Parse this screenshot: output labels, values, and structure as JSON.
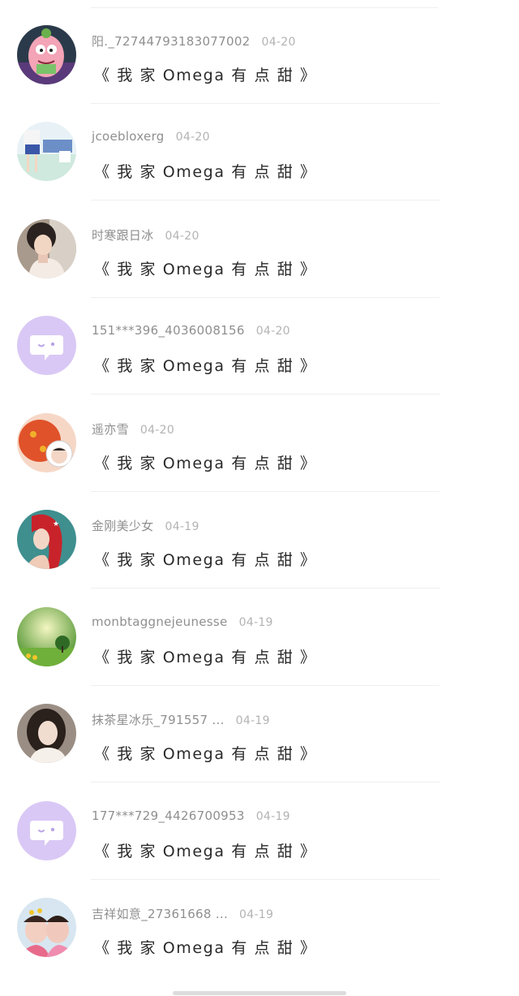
{
  "comments": [
    {
      "user": "阳._72744793183077002",
      "date": "04-20",
      "title": "《 我 家 Omega 有 点 甜 》",
      "avatar_icon": "patrick-star-avatar"
    },
    {
      "user": "jcoebloxerg",
      "date": "04-20",
      "title": "《 我 家 Omega 有 点 甜 》",
      "avatar_icon": "anime-girl-avatar"
    },
    {
      "user": "时寒跟日冰",
      "date": "04-20",
      "title": "《 我 家 Omega 有 点 甜 》",
      "avatar_icon": "girl-photo-avatar"
    },
    {
      "user": "151***396_4036008156",
      "date": "04-20",
      "title": "《 我 家 Omega 有 点 甜 》",
      "avatar_icon": "default-chat-avatar"
    },
    {
      "user": "遥亦雪",
      "date": "04-20",
      "title": "《 我 家 Omega 有 点 甜 》",
      "avatar_icon": "astronaut-cartoon-avatar"
    },
    {
      "user": "金刚美少女",
      "date": "04-19",
      "title": "《 我 家 Omega 有 点 甜 》",
      "avatar_icon": "mermaid-avatar"
    },
    {
      "user": "monbtaggnejeunesse",
      "date": "04-19",
      "title": "《 我 家 Omega 有 点 甜 》",
      "avatar_icon": "green-landscape-avatar"
    },
    {
      "user": "抹茶星冰乐_791557 ...",
      "date": "04-19",
      "title": "《 我 家 Omega 有 点 甜 》",
      "avatar_icon": "woman-portrait-avatar"
    },
    {
      "user": "177***729_4426700953",
      "date": "04-19",
      "title": "《 我 家 Omega 有 点 甜 》",
      "avatar_icon": "default-chat-avatar"
    },
    {
      "user": "吉祥如意_27361668 ...",
      "date": "04-19",
      "title": "《 我 家 Omega 有 点 甜 》",
      "avatar_icon": "two-girls-photo-avatar"
    }
  ],
  "colors": {
    "default_avatar_bg": "#d9c8f5",
    "title_text": "#2a2a2a",
    "meta_text": "#8f8f8f",
    "date_text": "#b3b3b3",
    "divider": "#efefef"
  }
}
